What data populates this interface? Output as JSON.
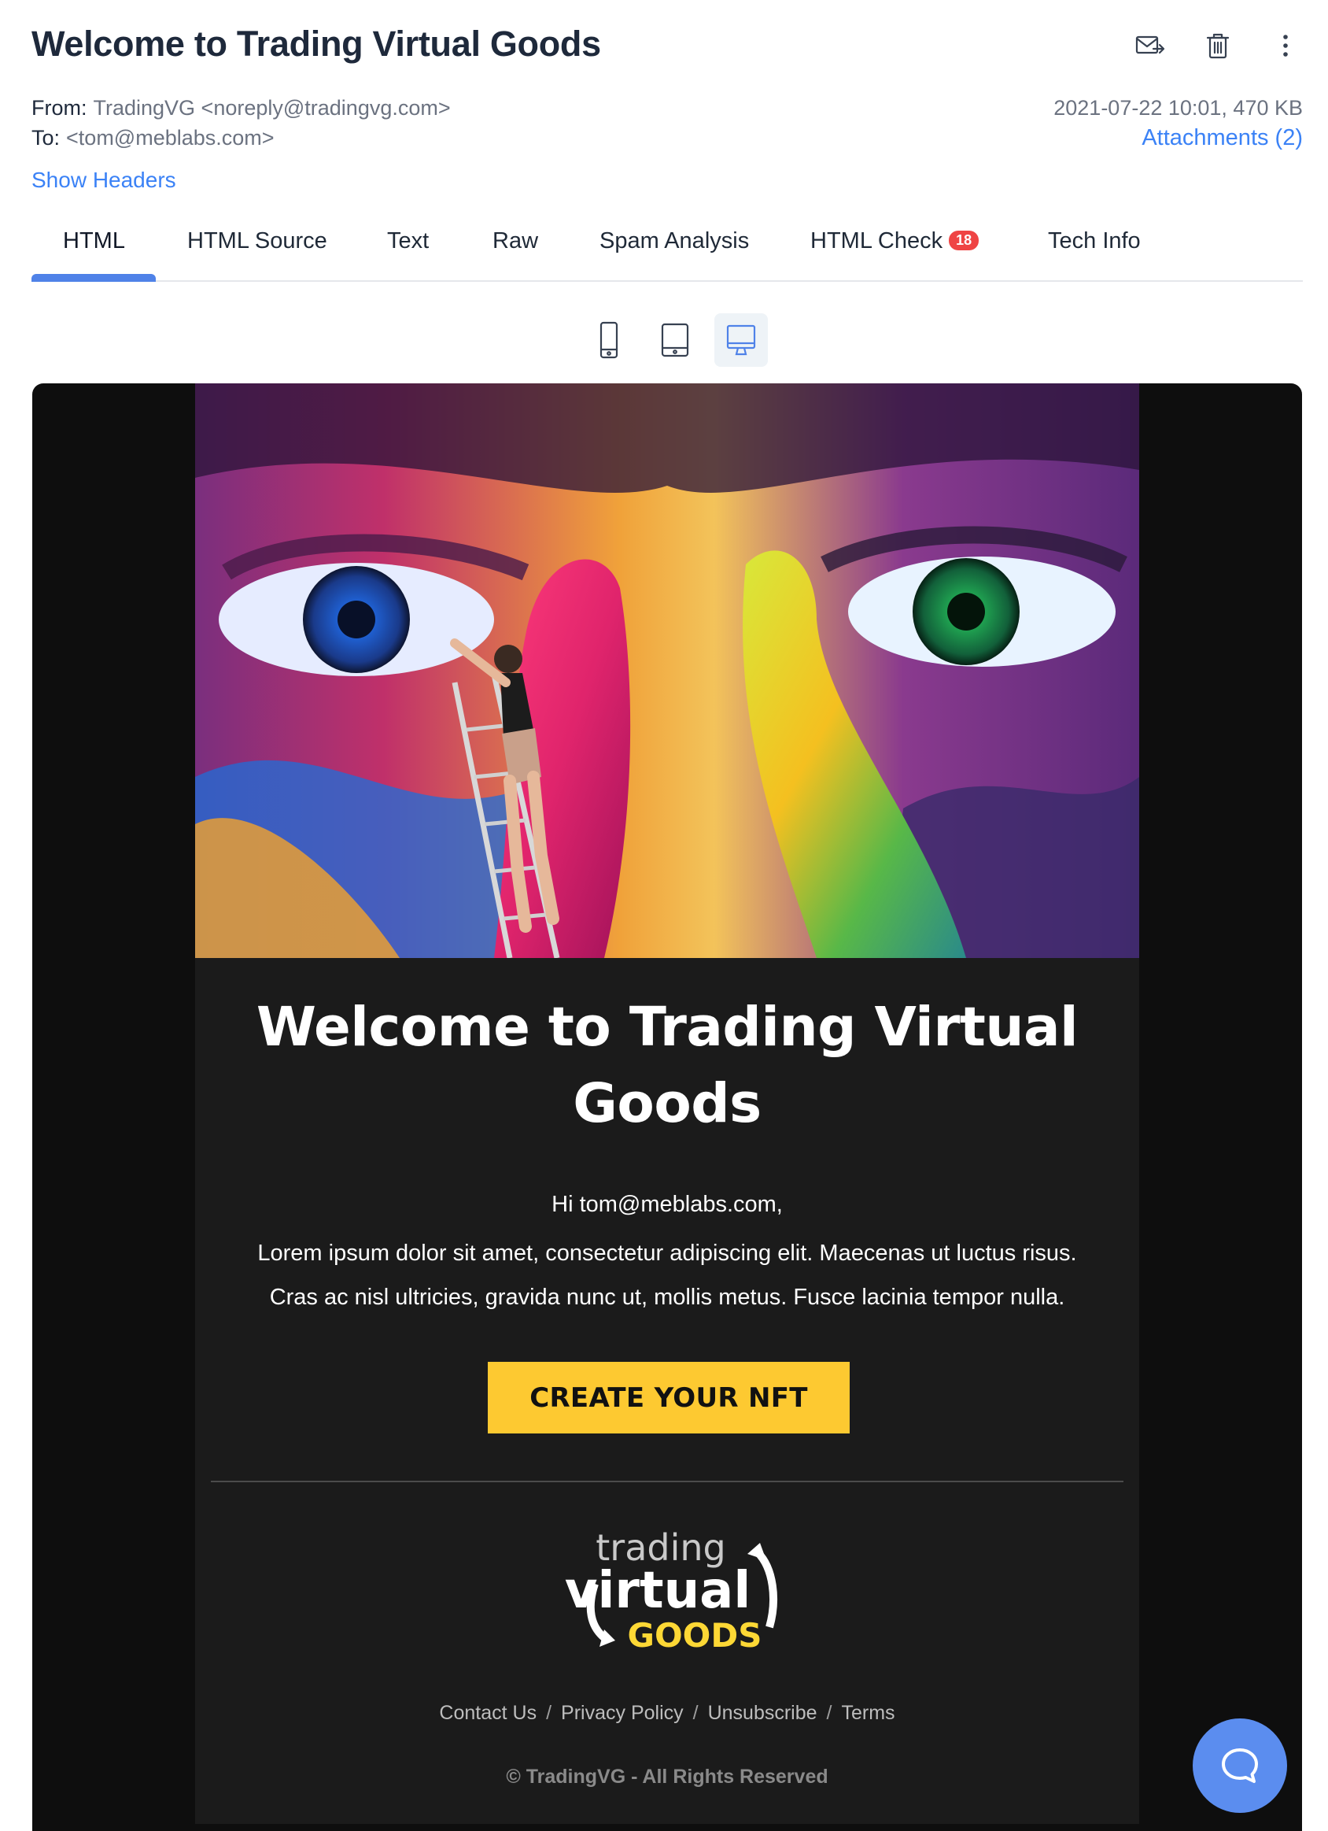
{
  "email": {
    "subject": "Welcome to Trading Virtual Goods",
    "from_label": "From:",
    "from_value": "TradingVG <noreply@tradingvg.com>",
    "to_label": "To:",
    "to_value": "<tom@meblabs.com>",
    "date_size": "2021-07-22 10:01, 470 KB",
    "attachments": "Attachments (2)",
    "show_headers": "Show Headers"
  },
  "actions": [
    "forward-icon",
    "trash-icon",
    "more-vertical-icon"
  ],
  "tabs": [
    {
      "label": "HTML"
    },
    {
      "label": "HTML Source"
    },
    {
      "label": "Text"
    },
    {
      "label": "Raw"
    },
    {
      "label": "Spam Analysis"
    },
    {
      "label": "HTML Check",
      "badge": "18"
    },
    {
      "label": "Tech Info"
    }
  ],
  "active_tab": "HTML",
  "devices": {
    "active": "desktop",
    "items": [
      "mobile-icon",
      "tablet-icon",
      "desktop-icon"
    ]
  },
  "preview": {
    "title": "Welcome to Trading Virtual Goods",
    "greeting": "Hi tom@meblabs.com,",
    "body_line1": "Lorem ipsum dolor sit amet, consectetur adipiscing elit. Maecenas ut luctus risus.",
    "body_line2": "Cras ac nisl ultricies, gravida nunc ut, mollis metus. Fusce lacinia tempor nulla.",
    "cta": "CREATE YOUR NFT",
    "logo_line1": "trading",
    "logo_line2": "virtual",
    "logo_line3": "GOODS",
    "footer_links": [
      "Contact Us",
      "Privacy Policy",
      "Unsubscribe",
      "Terms"
    ],
    "footer_sep": "/",
    "copyright": "© TradingVG  -  All Rights Reserved"
  },
  "colors": {
    "accent": "#3b82f6",
    "tab_underline": "#4f82e8",
    "badge": "#ef4444",
    "cta": "#fdc931",
    "email_bg": "#1b1b1b",
    "chat_button": "#5b8def"
  }
}
